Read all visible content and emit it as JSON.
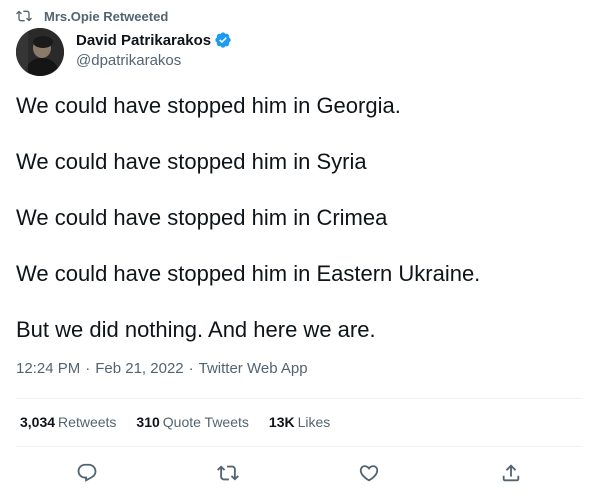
{
  "retweet_banner": {
    "text": "Mrs.Opie Retweeted",
    "icon": "retweet-icon"
  },
  "author": {
    "name": "David Patrikarakos",
    "handle": "@dpatrikarakos",
    "verified": true,
    "verified_color": "#1d9bf0"
  },
  "tweet": {
    "lines": [
      "We could have stopped him in Georgia.",
      "We could have stopped him in Syria",
      "We could have stopped him in Crimea",
      "We could have stopped him in Eastern Ukraine.",
      "But we did nothing. And here we are."
    ]
  },
  "meta": {
    "time": "12:24 PM",
    "separator": "·",
    "date": "Feb 21, 2022",
    "source": "Twitter Web App"
  },
  "stats": {
    "retweets": {
      "count": "3,034",
      "label": "Retweets"
    },
    "quotes": {
      "count": "310",
      "label": "Quote Tweets"
    },
    "likes": {
      "count": "13K",
      "label": "Likes"
    }
  },
  "actions": [
    "reply-icon",
    "retweet-icon",
    "like-icon",
    "share-icon"
  ],
  "colors": {
    "text": "#0f1419",
    "secondary": "#536471",
    "divider": "#eff3f4"
  }
}
